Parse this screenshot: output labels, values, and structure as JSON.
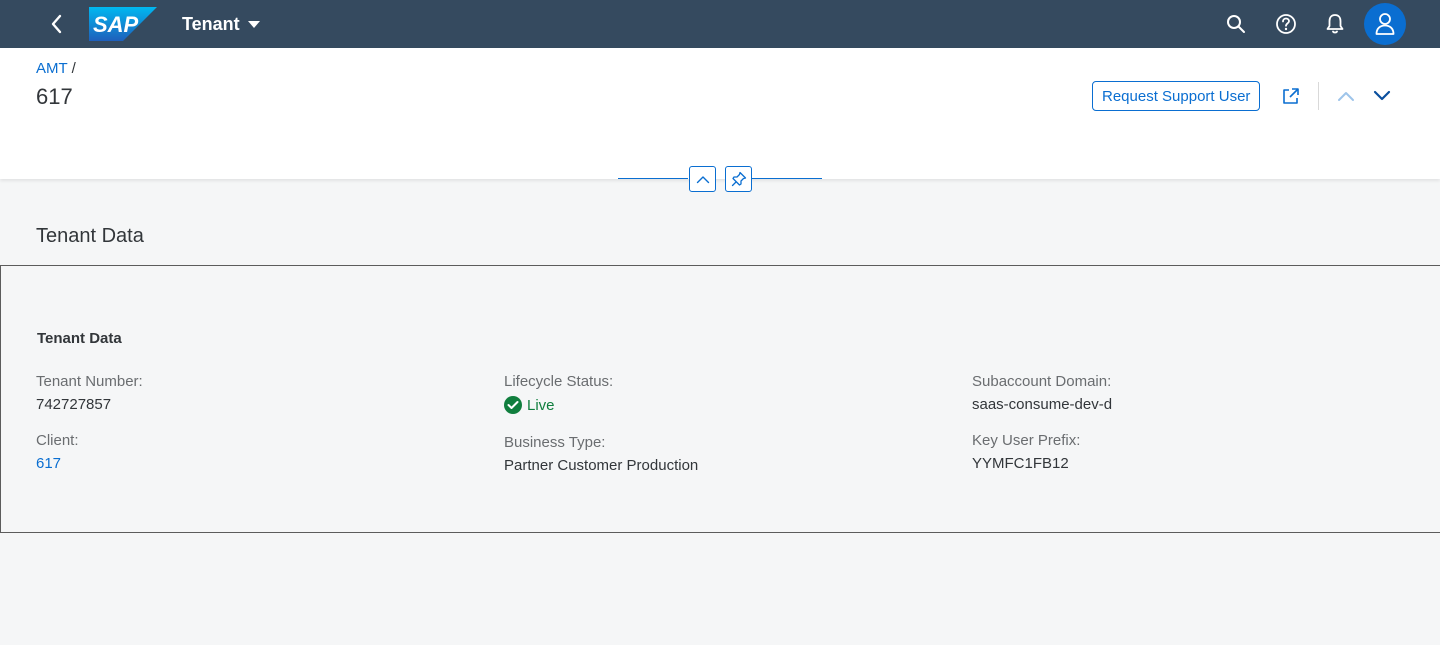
{
  "shellbar": {
    "logo_text": "SAP",
    "title": "Tenant",
    "icons": [
      "back-icon",
      "search-icon",
      "help-icon",
      "bell-icon",
      "user-icon"
    ],
    "color": "#354a5f"
  },
  "header": {
    "breadcrumb": {
      "link": "AMT",
      "separator": "/"
    },
    "title": "617",
    "actions": {
      "request_support_user": "Request Support User"
    }
  },
  "section": {
    "title": "Tenant Data",
    "panel_title": "Tenant Data",
    "fields": {
      "tenant_number": {
        "label": "Tenant Number:",
        "value": "742727857"
      },
      "client": {
        "label": "Client:",
        "value": "617"
      },
      "lifecycle_status": {
        "label": "Lifecycle Status:",
        "value": "Live",
        "color": "#107e3e"
      },
      "business_type": {
        "label": "Business Type:",
        "value": "Partner Customer Production"
      },
      "subaccount_domain": {
        "label": "Subaccount Domain:",
        "value": "saas-consume-dev-d"
      },
      "key_user_prefix": {
        "label": "Key User Prefix:",
        "value": "YYMFC1FB12"
      }
    }
  },
  "colors": {
    "accent": "#0a6ed1",
    "positive": "#107e3e",
    "shell": "#354a5f"
  }
}
